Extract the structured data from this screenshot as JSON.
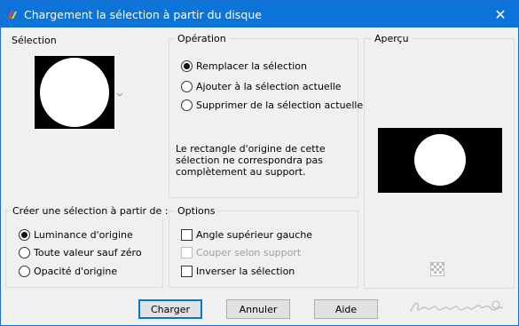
{
  "window": {
    "title": "Chargement la sélection à partir du disque",
    "accent": "#0c73d8"
  },
  "selection_panel": {
    "title": "Sélection"
  },
  "operation_panel": {
    "title": "Opération",
    "options": [
      {
        "label": "Remplacer la sélection",
        "checked": true
      },
      {
        "label": "Ajouter à la sélection actuelle",
        "checked": false
      },
      {
        "label": "Supprimer de la sélection actuelle",
        "checked": false
      }
    ],
    "info_lines": [
      "Le rectangle d'origine de cette",
      "sélection ne correspondra pas",
      "complètement au support."
    ]
  },
  "preview_panel": {
    "title": "Aperçu"
  },
  "source_panel": {
    "title": "Créer une sélection à partir de :",
    "options": [
      {
        "label": "Luminance d'origine",
        "checked": true
      },
      {
        "label": "Toute valeur sauf zéro",
        "checked": false
      },
      {
        "label": "Opacité d'origine",
        "checked": false
      }
    ]
  },
  "options_panel": {
    "title": "Options",
    "checks": [
      {
        "label": "Angle supérieur gauche",
        "checked": false,
        "enabled": true
      },
      {
        "label": "Couper selon support",
        "checked": false,
        "enabled": false
      },
      {
        "label": "Inverser la sélection",
        "checked": false,
        "enabled": true
      }
    ]
  },
  "buttons": {
    "charger": "Charger",
    "annuler": "Annuler",
    "aide": "Aide"
  }
}
